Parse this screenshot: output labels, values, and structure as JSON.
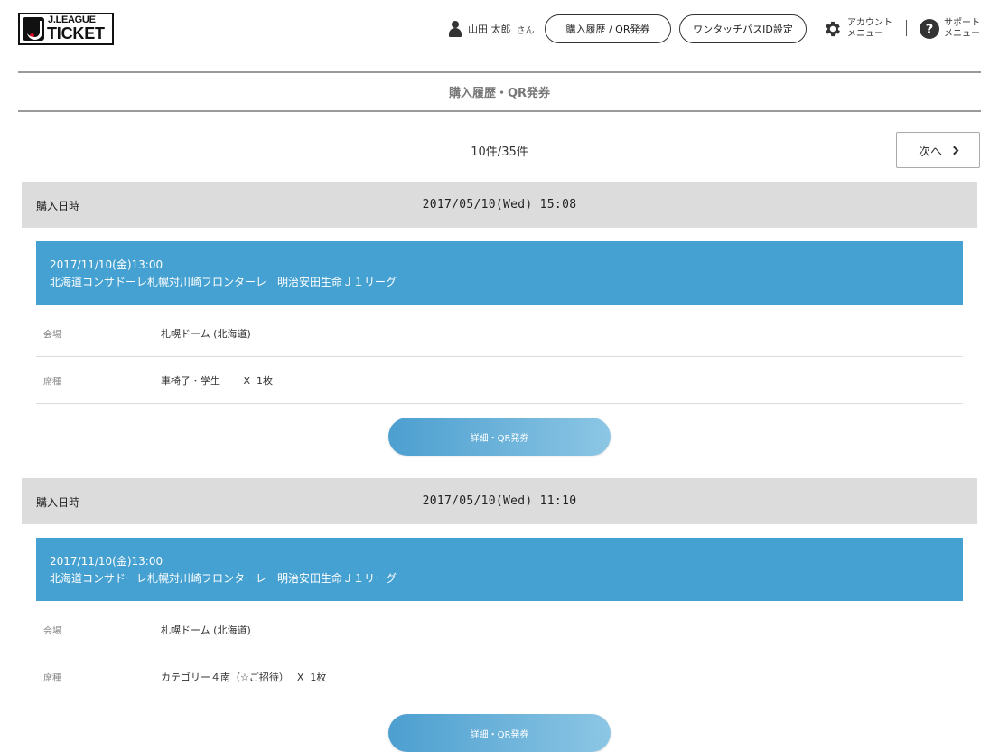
{
  "header": {
    "logo": {
      "top": "J.LEAGUE",
      "bottom": "TICKET"
    },
    "user": {
      "name": "山田 太郎",
      "suffix": "さん"
    },
    "buttons": {
      "history": "購入履歴 / QR発券",
      "onetouch": "ワンタッチパスID設定"
    },
    "menu": {
      "account": {
        "line1": "アカウント",
        "line2": "メニュー"
      },
      "support": {
        "line1": "サポート",
        "line2": "メニュー"
      }
    }
  },
  "page": {
    "title": "購入履歴・QR発券"
  },
  "pager": {
    "count": "10件/35件",
    "next_label": "次へ"
  },
  "purchases": [
    {
      "head_label": "購入日時",
      "purchased_at": "2017/05/10(Wed) 15:08",
      "event_date": "2017/11/10(金)13:00",
      "event_name": "北海道コンサドーレ札幌対川崎フロンターレ　明治安田生命Ｊ１リーグ",
      "venue_label": "会場",
      "venue": "札幌ドーム (北海道)",
      "seat_label": "席種",
      "seat": "車椅子・学生　　 X  1枚",
      "detail_button": "詳細・QR発券"
    },
    {
      "head_label": "購入日時",
      "purchased_at": "2017/05/10(Wed) 11:10",
      "event_date": "2017/11/10(金)13:00",
      "event_name": "北海道コンサドーレ札幌対川崎フロンターレ　明治安田生命Ｊ１リーグ",
      "venue_label": "会場",
      "venue": "札幌ドーム (北海道)",
      "seat_label": "席種",
      "seat": "カテゴリー４南（☆ご招待）　 X  1枚",
      "detail_button": "詳細・QR発券"
    }
  ],
  "colors": {
    "event_bar": "#45a1d1",
    "head_bar": "#dcdcdc",
    "button_start": "#4c9fd0",
    "button_end": "#8cc6e4"
  }
}
